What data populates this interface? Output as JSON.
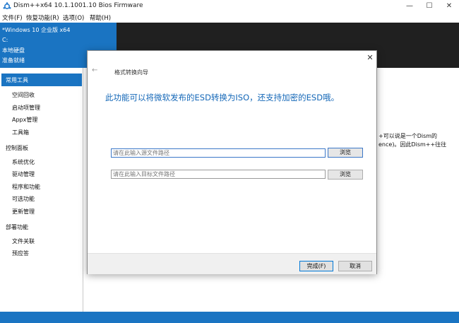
{
  "window": {
    "title": "Dism++x64 10.1.1001.10 Bios Firmware",
    "minimize_glyph": "—",
    "maximize_glyph": "☐",
    "close_glyph": "✕"
  },
  "menubar": {
    "items": [
      "文件(F)",
      "恢复功能(R)",
      "选项(O)",
      "帮助(H)"
    ]
  },
  "info": {
    "os": "*Windows 10 企业版 x64",
    "drive": "C:",
    "disk": "本地硬盘",
    "status": "准备就绪"
  },
  "sidebar": {
    "sections": [
      {
        "label": "常用工具",
        "active": true,
        "items": [
          "空间回收",
          "启动项管理",
          "Appx管理",
          "工具箱"
        ]
      },
      {
        "label": "控制面板",
        "items": [
          "系统优化",
          "驱动管理",
          "程序和功能",
          "可选功能",
          "更新管理"
        ]
      },
      {
        "label": "部署功能",
        "items": [
          "文件关联",
          "预应答"
        ]
      }
    ]
  },
  "background_text": {
    "line1": "+可以说是一个Dism的",
    "line2": "ence)。因此Dism++往往"
  },
  "dialog": {
    "title": "格式转换向导",
    "back_glyph": "←",
    "close_glyph": "✕",
    "description": "此功能可以将微软发布的ESD转换为ISO，还支持加密的ESD哦。",
    "source_input": {
      "value": "",
      "placeholder": "请在此输入源文件路径"
    },
    "target_input": {
      "value": "",
      "placeholder": "请在此输入目标文件路径"
    },
    "browse_label": "浏览",
    "finish_label": "完成(F)",
    "cancel_label": "取消"
  },
  "colors": {
    "accent": "#1a74c2",
    "dark_band": "#202020",
    "description_text": "#1568b8"
  }
}
